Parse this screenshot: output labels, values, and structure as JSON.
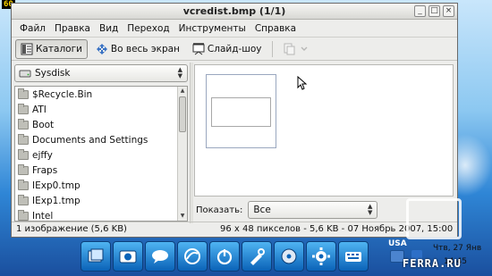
{
  "overlay": {
    "fps": "60"
  },
  "window": {
    "title": "vcredist.bmp  (1/1)",
    "controls": {
      "minimize": "_",
      "maximize": "□",
      "close": "×"
    }
  },
  "menubar": {
    "items": [
      "Файл",
      "Правка",
      "Вид",
      "Переход",
      "Инструменты",
      "Справка"
    ]
  },
  "toolbar": {
    "catalogs": "Каталоги",
    "fullscreen": "Во весь экран",
    "slideshow": "Слайд-шоу"
  },
  "sidebar": {
    "location": "Sysdisk",
    "items": [
      "$Recycle.Bin",
      "ATI",
      "Boot",
      "Documents and Settings",
      "ejffy",
      "Fraps",
      "IExp0.tmp",
      "IExp1.tmp",
      "Intel"
    ]
  },
  "filter": {
    "label": "Показать:",
    "value": "Все"
  },
  "status": {
    "left": "1 изображение (5,6 KB)",
    "right": "96 x 48 пикселов - 5,6 KB - 07 Ноябрь 2007, 15:00"
  },
  "tray": {
    "lang": "USA",
    "date": "Чтв, 27 Янв",
    "time": "14:45"
  },
  "watermark": {
    "text": "FERRA.RU"
  },
  "colors": {
    "accent": "#0b63b8",
    "window_bg": "#ededeb",
    "taskbar_icon": "#4fb4f2"
  }
}
